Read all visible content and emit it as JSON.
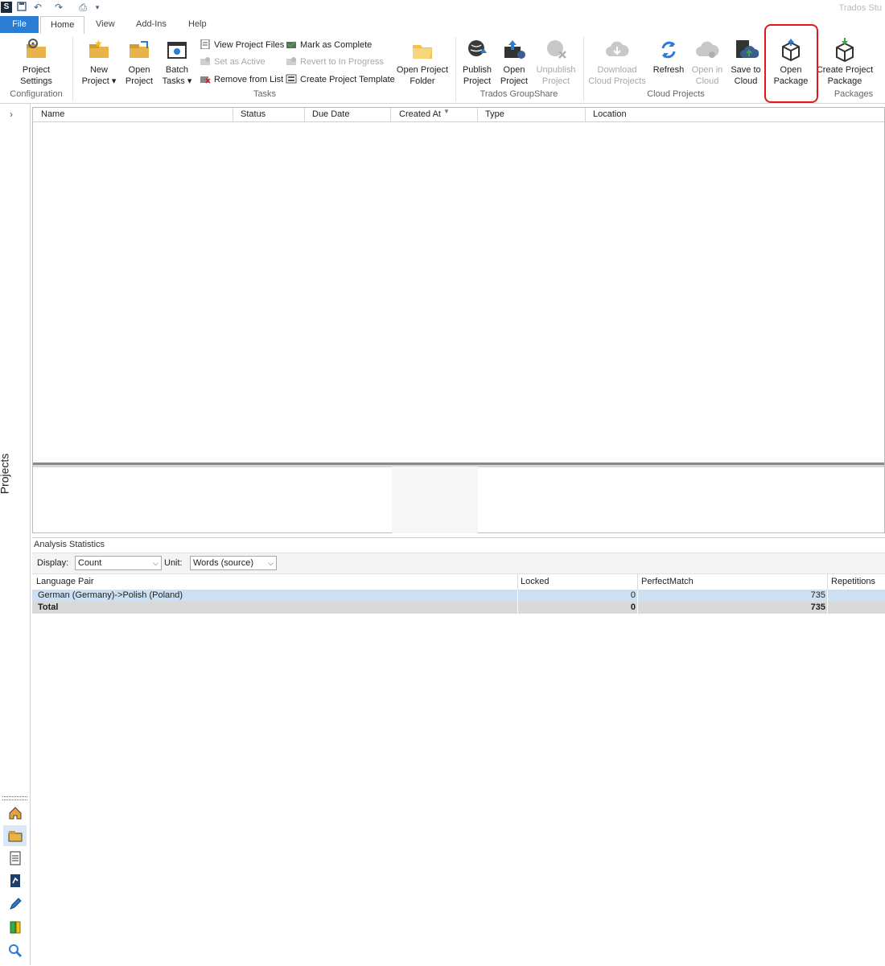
{
  "app": {
    "title": "Trados Stu"
  },
  "tabs": {
    "file": "File",
    "home": "Home",
    "view": "View",
    "addins": "Add-Ins",
    "help": "Help"
  },
  "ribbon": {
    "configuration": {
      "project_settings": "Project\nSettings",
      "label": "Configuration"
    },
    "tasks": {
      "new_project": "New\nProject ▾",
      "open_project": "Open\nProject",
      "batch_tasks": "Batch\nTasks ▾",
      "view_project_files": "View Project Files",
      "set_as_active": "Set as Active",
      "remove_from_list": "Remove from List",
      "mark_as_complete": "Mark as Complete",
      "revert_to_in_progress": "Revert to In Progress",
      "create_project_template": "Create Project Template",
      "open_project_folder": "Open Project\nFolder",
      "label": "Tasks"
    },
    "groupshare": {
      "publish_project": "Publish\nProject",
      "open_project": "Open\nProject",
      "unpublish_project": "Unpublish\nProject",
      "label": "Trados GroupShare"
    },
    "cloud": {
      "download_cloud_projects": "Download\nCloud Projects",
      "refresh": "Refresh",
      "open_in_cloud": "Open in\nCloud",
      "save_to_cloud": "Save to\nCloud",
      "label": "Cloud Projects"
    },
    "packages": {
      "open_package": "Open\nPackage",
      "create_project_package": "Create Project\nPackage",
      "label": "Packages"
    }
  },
  "nav": {
    "projects_label": "Projects",
    "expand": "›"
  },
  "grid": {
    "columns": [
      "Name",
      "Status",
      "Due Date",
      "Created At",
      "Type",
      "Location"
    ]
  },
  "analysis": {
    "title": "Analysis Statistics",
    "display_label": "Display:",
    "display_value": "Count",
    "unit_label": "Unit:",
    "unit_value": "Words (source)",
    "columns": [
      "Language Pair",
      "Locked",
      "PerfectMatch",
      "Repetitions"
    ],
    "rows": [
      {
        "pair": "German (Germany)->Polish (Poland)",
        "locked": "0",
        "perfect": "735"
      }
    ],
    "total": {
      "label": "Total",
      "locked": "0",
      "perfect": "735"
    }
  },
  "colors": {
    "accent": "#2b7cd3",
    "highlight": "#e0191b",
    "selected_row": "#cde0f3"
  }
}
